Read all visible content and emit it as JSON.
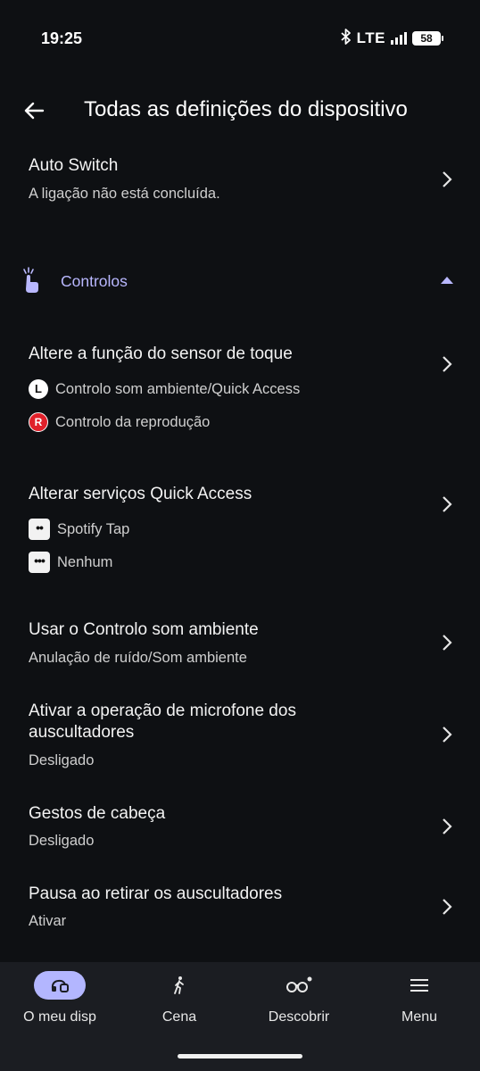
{
  "status_bar": {
    "time": "19:25",
    "network": "LTE",
    "battery": "58"
  },
  "header": {
    "title": "Todas as definições do dispositivo"
  },
  "auto_switch": {
    "title": "Auto Switch",
    "subtitle": "A ligação não está concluída."
  },
  "section": {
    "label": "Controlos"
  },
  "touch_sensor": {
    "title": "Altere a função do sensor de toque",
    "left_badge": "L",
    "left_value": "Controlo som ambiente/Quick Access",
    "right_badge": "R",
    "right_value": "Controlo da reprodução"
  },
  "quick_access": {
    "title": "Alterar serviços Quick Access",
    "item1_badge": "••",
    "item1": "Spotify Tap",
    "item2_badge": "•••",
    "item2": "Nenhum"
  },
  "ambient": {
    "title": "Usar o Controlo som ambiente",
    "subtitle": "Anulação de ruído/Som ambiente"
  },
  "mic_operation": {
    "title_line1": "Ativar a operação de microfone dos",
    "title_line2": "auscultadores",
    "subtitle": "Desligado"
  },
  "head_gestures": {
    "title": "Gestos de cabeça",
    "subtitle": "Desligado"
  },
  "pause_removal": {
    "title": "Pausa ao retirar os auscultadores",
    "subtitle": "Ativar"
  },
  "bottom_nav": [
    {
      "label": "O meu disp",
      "icon": "headphones-icon",
      "active": true
    },
    {
      "label": "Cena",
      "icon": "walking-person-icon",
      "active": false
    },
    {
      "label": "Descobrir",
      "icon": "binoculars-icon",
      "active": false
    },
    {
      "label": "Menu",
      "icon": "hamburger-menu-icon",
      "active": false
    }
  ],
  "colors": {
    "background": "#0e1013",
    "accent": "#b9b8ff",
    "nav_active": "#b3b6ff",
    "nav_bg": "#1b1d22",
    "red_badge": "#e0202a"
  }
}
